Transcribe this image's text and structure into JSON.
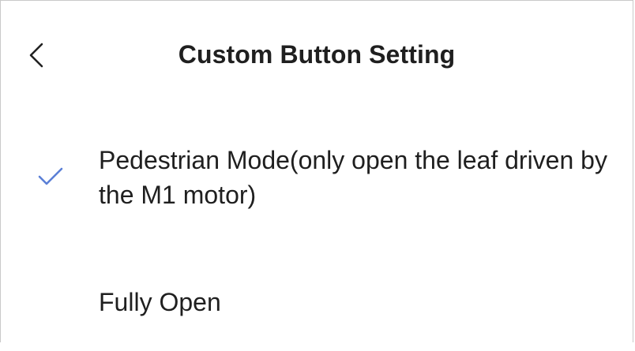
{
  "header": {
    "back_icon": "chevron-left-icon",
    "title": "Custom Button Setting"
  },
  "options": [
    {
      "label": "Pedestrian Mode(only open the leaf driven by the M1 motor)",
      "selected": true,
      "check_icon": "check-icon",
      "check_color": "#5b7fd6"
    },
    {
      "label": "Fully Open",
      "selected": false
    }
  ],
  "colors": {
    "text": "#1f1f1f",
    "accent": "#5b7fd6",
    "background": "#ffffff"
  }
}
